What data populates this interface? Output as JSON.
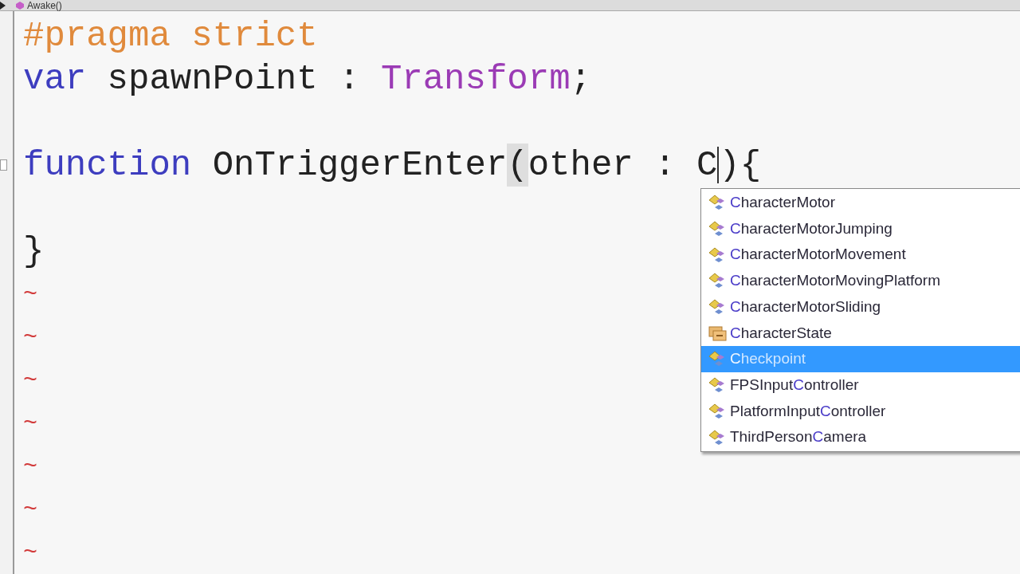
{
  "breadcrumb": {
    "label": "Awake()"
  },
  "code_lines": [
    {
      "fold": false,
      "tokens": [
        {
          "text": "#pragma strict",
          "kind": "directive"
        }
      ]
    },
    {
      "fold": false,
      "tokens": [
        {
          "text": "var",
          "kind": "keyword"
        },
        {
          "text": " spawnPoint : ",
          "kind": "plain"
        },
        {
          "text": "Transform",
          "kind": "type"
        },
        {
          "text": ";",
          "kind": "plain"
        }
      ]
    },
    {
      "fold": false
    },
    {
      "fold": true,
      "tokens": [
        {
          "text": "function",
          "kind": "keyword"
        },
        {
          "text": " OnTriggerEnter",
          "kind": "plain"
        },
        {
          "text": "(",
          "kind": "plain",
          "matched": true
        },
        {
          "text": "other : ",
          "kind": "plain"
        },
        {
          "text": "C",
          "kind": "plain",
          "caret": true
        },
        {
          "text": "){",
          "kind": "plain"
        }
      ]
    },
    {
      "fold": false
    },
    {
      "fold": false,
      "tokens": [
        {
          "text": "}",
          "kind": "plain"
        }
      ]
    },
    {
      "fold": false,
      "tokens": [
        {
          "text": "~",
          "kind": "filler"
        }
      ]
    },
    {
      "fold": false,
      "tokens": [
        {
          "text": "~",
          "kind": "filler"
        }
      ]
    },
    {
      "fold": false,
      "tokens": [
        {
          "text": "~",
          "kind": "filler"
        }
      ]
    },
    {
      "fold": false,
      "tokens": [
        {
          "text": "~",
          "kind": "filler"
        }
      ]
    },
    {
      "fold": false,
      "tokens": [
        {
          "text": "~",
          "kind": "filler"
        }
      ]
    },
    {
      "fold": false,
      "tokens": [
        {
          "text": "~",
          "kind": "filler"
        }
      ]
    },
    {
      "fold": false,
      "tokens": [
        {
          "text": "~",
          "kind": "filler"
        }
      ]
    }
  ],
  "completion_list": [
    {
      "kind": "class",
      "selected": false,
      "parts": [
        {
          "text": "C",
          "match": true
        },
        {
          "text": "haracterMotor",
          "match": false
        }
      ]
    },
    {
      "kind": "class",
      "selected": false,
      "parts": [
        {
          "text": "C",
          "match": true
        },
        {
          "text": "haracterMotorJumping",
          "match": false
        }
      ]
    },
    {
      "kind": "class",
      "selected": false,
      "parts": [
        {
          "text": "C",
          "match": true
        },
        {
          "text": "haracterMotorMovement",
          "match": false
        }
      ]
    },
    {
      "kind": "class",
      "selected": false,
      "parts": [
        {
          "text": "C",
          "match": true
        },
        {
          "text": "haracterMotorMovingPlatform",
          "match": false
        }
      ]
    },
    {
      "kind": "class",
      "selected": false,
      "parts": [
        {
          "text": "C",
          "match": true
        },
        {
          "text": "haracterMotorSliding",
          "match": false
        }
      ]
    },
    {
      "kind": "enum",
      "selected": false,
      "parts": [
        {
          "text": "C",
          "match": true
        },
        {
          "text": "haracterState",
          "match": false
        }
      ]
    },
    {
      "kind": "class",
      "selected": true,
      "parts": [
        {
          "text": "C",
          "match": true
        },
        {
          "text": "heckpoint",
          "match": false
        }
      ]
    },
    {
      "kind": "class",
      "selected": false,
      "parts": [
        {
          "text": "FPSInput",
          "match": false
        },
        {
          "text": "C",
          "match": true
        },
        {
          "text": "ontroller",
          "match": false
        }
      ]
    },
    {
      "kind": "class",
      "selected": false,
      "parts": [
        {
          "text": "PlatformInput",
          "match": false
        },
        {
          "text": "C",
          "match": true
        },
        {
          "text": "ontroller",
          "match": false
        }
      ]
    },
    {
      "kind": "class",
      "selected": false,
      "parts": [
        {
          "text": "ThirdPerson",
          "match": false
        },
        {
          "text": "C",
          "match": true
        },
        {
          "text": "amera",
          "match": false
        }
      ]
    }
  ]
}
